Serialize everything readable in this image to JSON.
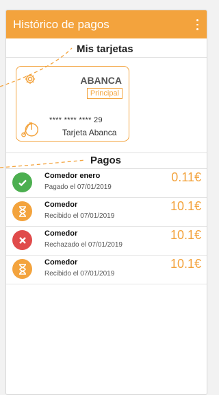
{
  "appbar": {
    "title": "Histórico de pagos",
    "menu_icon": "more-vert-icon"
  },
  "cards_section": {
    "title": "Mis tarjetas"
  },
  "card": {
    "bank": "ABANCA",
    "badge": "Principal",
    "number": "**** **** **** 29",
    "name": "Tarjeta Abanca",
    "settings_icon": "gear-icon",
    "logo_icon": "penny-farthing-icon"
  },
  "payments_section": {
    "title": "Pagos"
  },
  "payments": [
    {
      "status": "paid",
      "icon": "check-icon",
      "title": "Comedor enero",
      "subtitle": "Pagado el 07/01/2019",
      "amount": "0.11€"
    },
    {
      "status": "received",
      "icon": "hourglass-icon",
      "title": "Comedor",
      "subtitle": "Recibido el 07/01/2019",
      "amount": "10.1€"
    },
    {
      "status": "rejected",
      "icon": "close-icon",
      "title": "Comedor",
      "subtitle": "Rechazado el 07/01/2019",
      "amount": "10.1€"
    },
    {
      "status": "received",
      "icon": "hourglass-icon",
      "title": "Comedor",
      "subtitle": "Recibido el 07/01/2019",
      "amount": "10.1€"
    }
  ],
  "colors": {
    "accent": "#f3a33d",
    "ok": "#4caf50",
    "rejected": "#e04b4b"
  }
}
